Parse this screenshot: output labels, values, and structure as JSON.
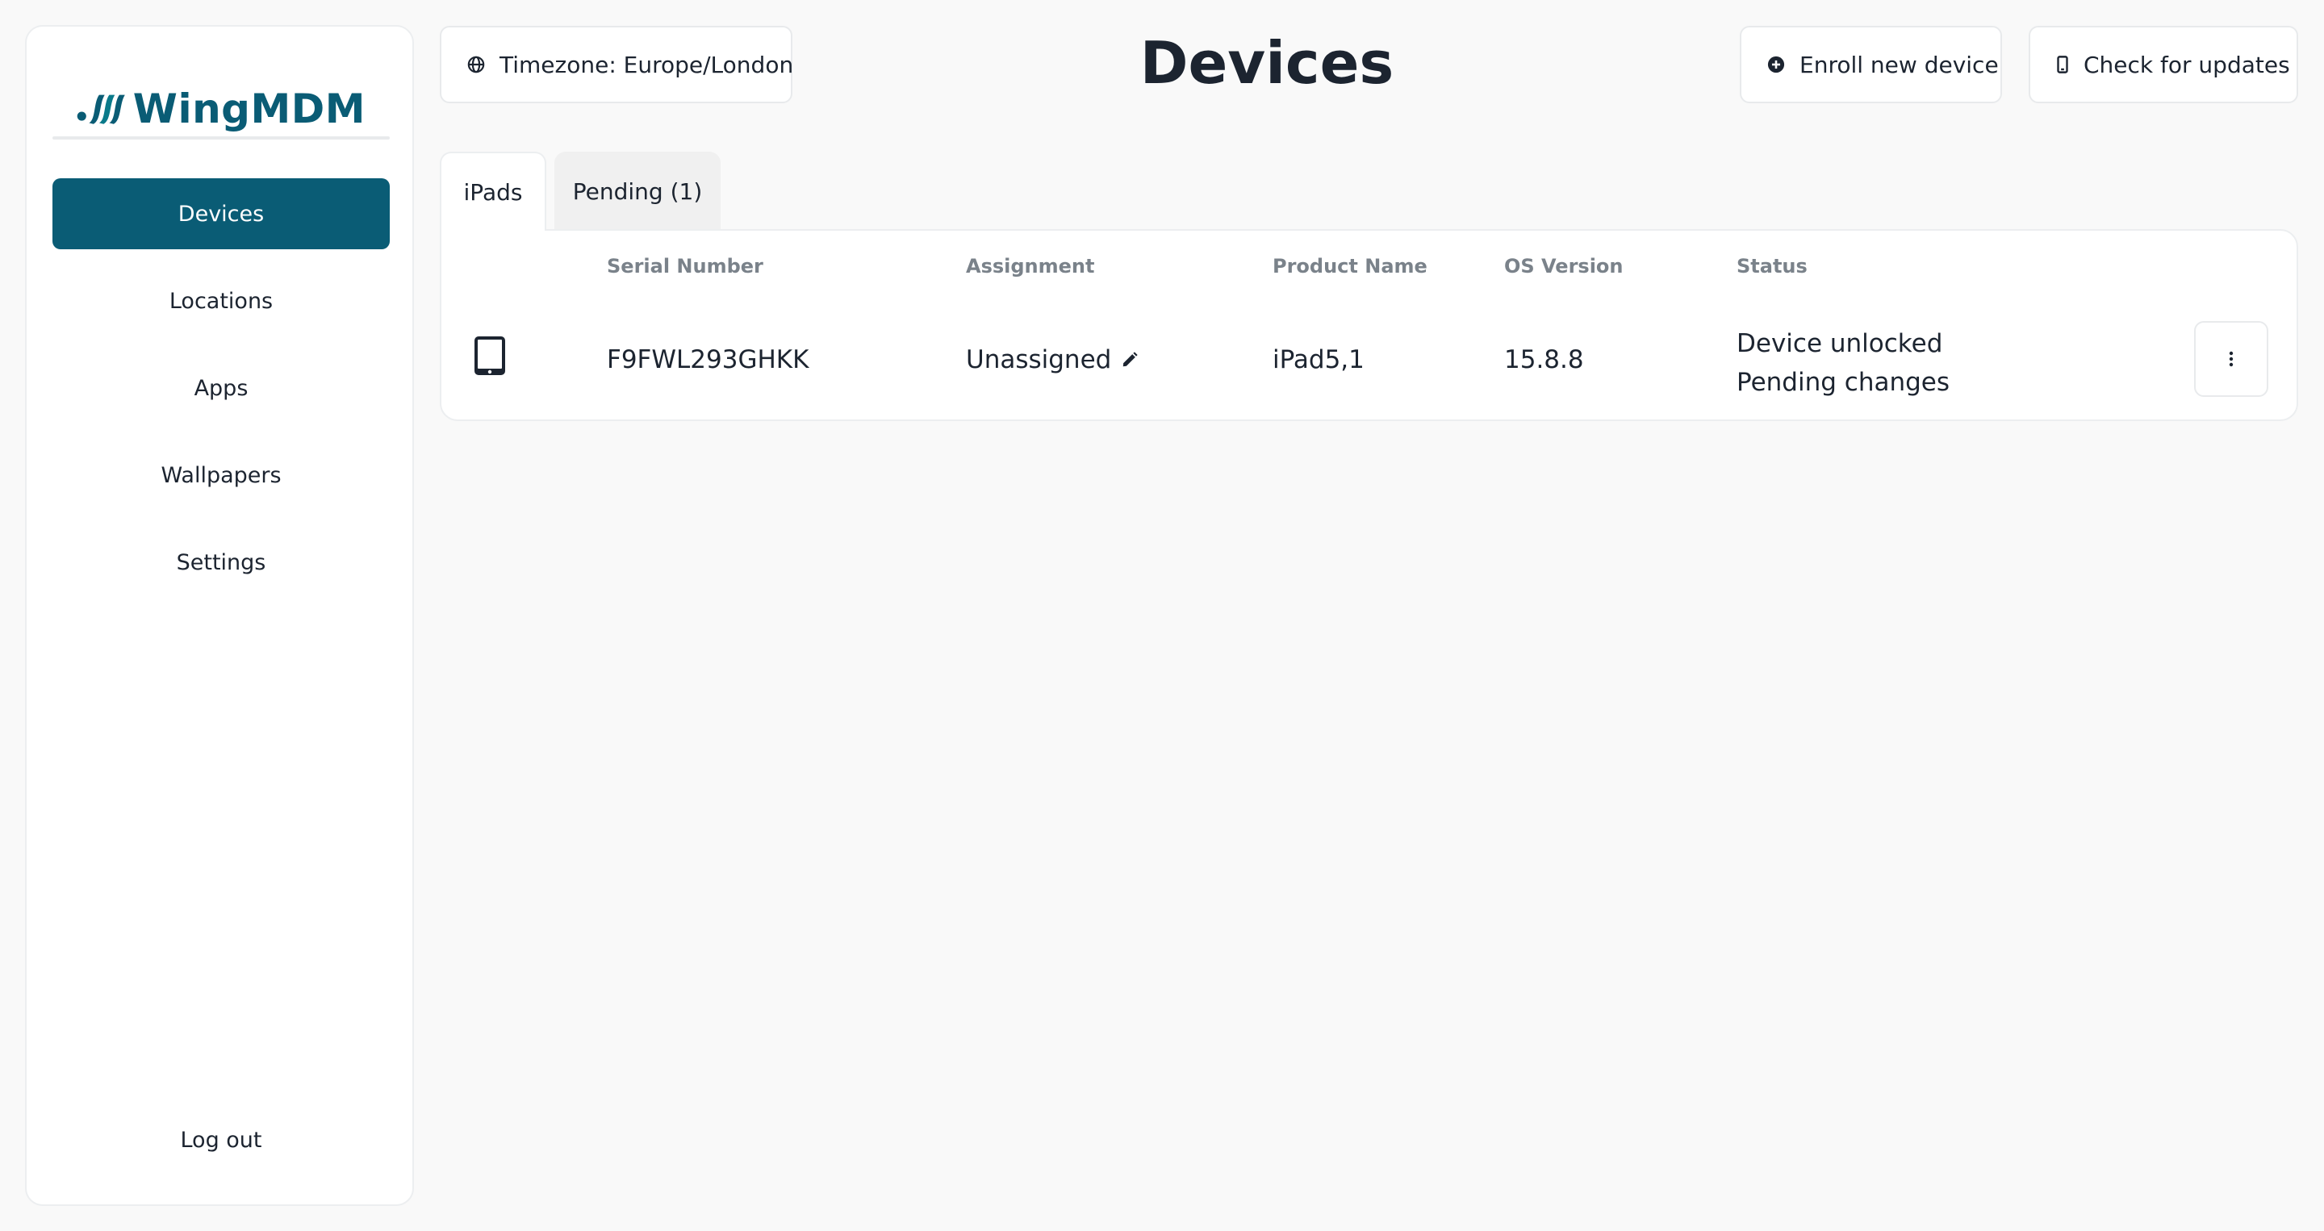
{
  "brand": {
    "name": "WingMDM",
    "color": "#0a5c75"
  },
  "sidebar": {
    "items": [
      {
        "label": "Devices",
        "active": true
      },
      {
        "label": "Locations",
        "active": false
      },
      {
        "label": "Apps",
        "active": false
      },
      {
        "label": "Wallpapers",
        "active": false
      },
      {
        "label": "Settings",
        "active": false
      }
    ],
    "logout_label": "Log out"
  },
  "header": {
    "timezone_label": "Timezone: Europe/London",
    "timezone_icon": "globe-icon",
    "title": "Devices",
    "enroll_label": "Enroll new device",
    "enroll_icon": "plus-circle-icon",
    "update_label": "Check for updates",
    "update_icon": "phone-icon"
  },
  "tabs": [
    {
      "label": "iPads",
      "active": true
    },
    {
      "label": "Pending (1)",
      "active": false
    }
  ],
  "table": {
    "columns": [
      "Serial Number",
      "Assignment",
      "Product Name",
      "OS Version",
      "Status"
    ],
    "rows": [
      {
        "icon": "tablet-icon",
        "serial": "F9FWL293GHKK",
        "assignment": "Unassigned",
        "product": "iPad5,1",
        "os_version": "15.8.8",
        "status": [
          "Device unlocked",
          "Pending changes"
        ]
      }
    ]
  }
}
